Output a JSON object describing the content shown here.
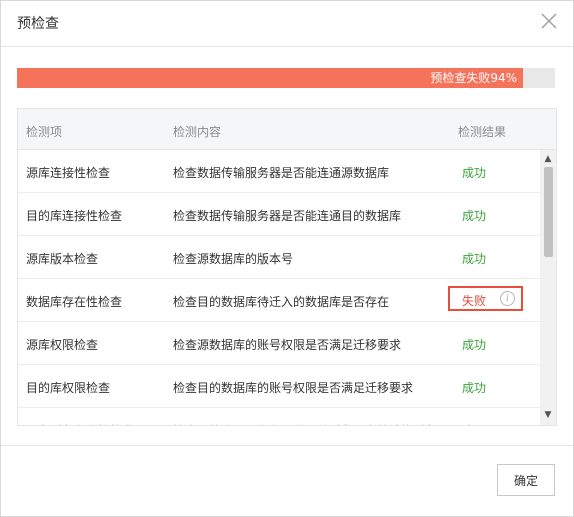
{
  "dialog": {
    "title": "预检查",
    "close_icon": "close-icon"
  },
  "progress": {
    "label": "预检查失败94%",
    "percent": 94,
    "fill_color": "#f5735a",
    "track_color": "#e8e8e8"
  },
  "table": {
    "headers": [
      "检测项",
      "检测内容",
      "检测结果"
    ],
    "rows": [
      {
        "item": "源库连接性检查",
        "content": "检查数据传输服务器是否能连通源数据库",
        "result": "成功",
        "status": "success"
      },
      {
        "item": "目的库连接性检查",
        "content": "检查数据传输服务器是否能连通目的数据库",
        "result": "成功",
        "status": "success"
      },
      {
        "item": "源库版本检查",
        "content": "检查源数据库的版本号",
        "result": "成功",
        "status": "success"
      },
      {
        "item": "数据库存在性检查",
        "content": "检查目的数据库待迁入的数据库是否存在",
        "result": "失败",
        "status": "fail",
        "icon": "info-icon"
      },
      {
        "item": "源库权限检查",
        "content": "检查源数据库的账号权限是否满足迁移要求",
        "result": "成功",
        "status": "success"
      },
      {
        "item": "目的库权限检查",
        "content": "检查目的数据库的账号权限是否满足迁移要求",
        "result": "成功",
        "status": "success"
      },
      {
        "item": "同名对象存在性检查",
        "content": "检查目的库是否存在跟待迁移对象同名的结构对象",
        "result": "成功",
        "status": "success"
      }
    ]
  },
  "colors": {
    "success": "#3aa53a",
    "fail": "#e74c3c"
  },
  "footer": {
    "confirm_label": "确定"
  }
}
